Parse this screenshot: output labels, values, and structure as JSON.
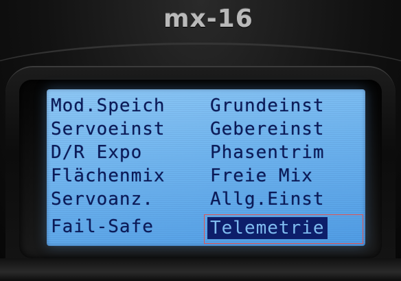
{
  "device": {
    "brand": "mx-16"
  },
  "menu": {
    "left": [
      "Mod.Speich",
      "Servoeinst",
      "D/R Expo",
      "Flächenmix",
      "Servoanz.",
      "Fail-Safe"
    ],
    "right": [
      "Grundeinst",
      "Gebereinst",
      "Phasentrim",
      "Freie Mix",
      "Allg.Einst",
      "Telemetrie"
    ],
    "selected": "Telemetrie"
  },
  "colors": {
    "lcd_background": "#6fb4ee",
    "lcd_text": "#0b1a57",
    "selection_background": "#0d1e6a",
    "highlight_border": "#e0524f"
  }
}
